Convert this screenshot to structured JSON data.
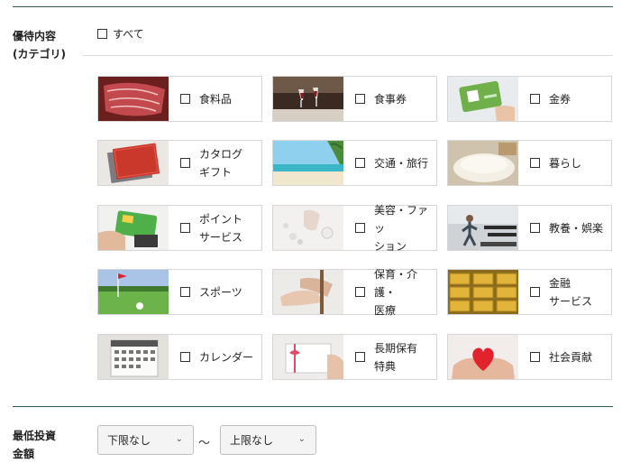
{
  "section_category": {
    "label_line1": "優待内容",
    "label_line2": "(カテゴリ)",
    "all_label": "すべて",
    "items": [
      {
        "label": "食料品",
        "icon": "beef-photo"
      },
      {
        "label": "食事券",
        "icon": "wine-toast-photo"
      },
      {
        "label": "金券",
        "icon": "gift-card-photo"
      },
      {
        "label": "カタログ\nギフト",
        "icon": "catalog-photo"
      },
      {
        "label": "交通・旅行",
        "icon": "beach-photo"
      },
      {
        "label": "暮らし",
        "icon": "rice-photo"
      },
      {
        "label": "ポイント\nサービス",
        "icon": "point-card-photo"
      },
      {
        "label": "美容・ファッ\nション",
        "icon": "cosmetics-photo"
      },
      {
        "label": "教養・娯楽",
        "icon": "treadmill-photo"
      },
      {
        "label": "スポーツ",
        "icon": "golf-photo"
      },
      {
        "label": "保育・介護・\n医療",
        "icon": "care-hands-photo"
      },
      {
        "label": "金融\nサービス",
        "icon": "gold-bars-photo"
      },
      {
        "label": "カレンダー",
        "icon": "calendar-photo"
      },
      {
        "label": "長期保有\n特典",
        "icon": "gift-envelope-photo"
      },
      {
        "label": "社会貢献",
        "icon": "heart-hands-photo"
      }
    ]
  },
  "section_investment": {
    "label_line1": "最低投資",
    "label_line2": "金額",
    "min_select": "下限なし",
    "separator": "～",
    "max_select": "上限なし"
  }
}
